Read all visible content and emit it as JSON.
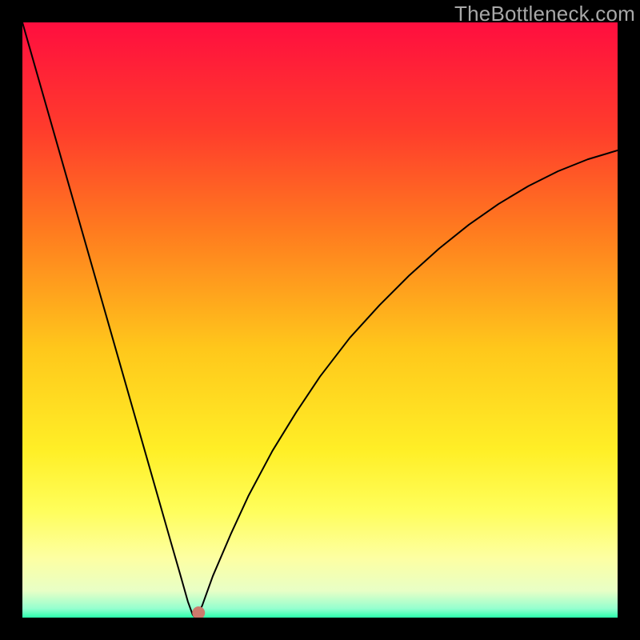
{
  "watermark": "TheBottleneck.com",
  "chart_data": {
    "type": "line",
    "title": "",
    "xlabel": "",
    "ylabel": "",
    "xlim": [
      0,
      100
    ],
    "ylim": [
      0,
      100
    ],
    "grid": false,
    "legend": null,
    "background": {
      "type": "vertical-gradient",
      "stops": [
        {
          "pos": 0.0,
          "color": "#ff0e3f"
        },
        {
          "pos": 0.18,
          "color": "#ff3c2c"
        },
        {
          "pos": 0.35,
          "color": "#ff7b1f"
        },
        {
          "pos": 0.55,
          "color": "#ffc81b"
        },
        {
          "pos": 0.72,
          "color": "#ffef27"
        },
        {
          "pos": 0.82,
          "color": "#fffe5b"
        },
        {
          "pos": 0.9,
          "color": "#fdffa2"
        },
        {
          "pos": 0.955,
          "color": "#e8ffc6"
        },
        {
          "pos": 0.985,
          "color": "#94ffcf"
        },
        {
          "pos": 1.0,
          "color": "#2bffac"
        }
      ]
    },
    "curve": {
      "x": [
        0,
        2,
        5,
        8,
        11,
        14,
        17,
        20,
        23,
        25,
        26.5,
        27.8,
        28.6,
        29.0,
        29.4,
        30.2,
        32,
        35,
        38,
        42,
        46,
        50,
        55,
        60,
        65,
        70,
        75,
        80,
        85,
        90,
        95,
        100
      ],
      "y": [
        100,
        93,
        82.5,
        72,
        61.5,
        51,
        40.5,
        30,
        19.5,
        12.5,
        7.3,
        2.7,
        0.5,
        0.0,
        0.5,
        2.0,
        7.0,
        14.0,
        20.5,
        28.0,
        34.5,
        40.5,
        47.0,
        52.5,
        57.5,
        62.0,
        66.0,
        69.5,
        72.5,
        75.0,
        77.0,
        78.5
      ]
    },
    "marker": {
      "x": 29.6,
      "y": 0.8,
      "color": "#cd7a6d",
      "size": 8
    },
    "curve_color": "#000000",
    "curve_width": 2
  }
}
